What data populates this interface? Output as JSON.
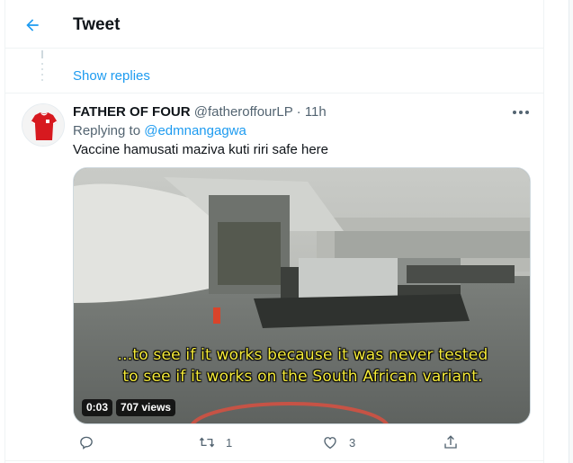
{
  "header": {
    "title": "Tweet",
    "back_icon": "arrow-left-icon"
  },
  "thread": {
    "show_replies": "Show replies"
  },
  "tweet": {
    "display_name": "FATHER OF FOUR",
    "handle": "@fatheroffourLP",
    "separator": "·",
    "time": "11h",
    "replying_prefix": "Replying to",
    "replying_to": "@edmnangagwa",
    "text": "Vaccine hamusati maziva kuti riri safe here",
    "more_icon": "more-horizontal-icon",
    "avatar_icon": "jersey-avatar",
    "video": {
      "subtitle_line1": "...to see if it works because it was never tested",
      "subtitle_line2": "to see if it works on the South African variant.",
      "duration": "0:03",
      "views": "707 views"
    },
    "actions": {
      "reply_count": "",
      "retweet_count": "1",
      "like_count": "3",
      "share_count": ""
    }
  },
  "colors": {
    "accent": "#1d9bf0",
    "text_primary": "#0f1419",
    "text_secondary": "#536471",
    "subtitle_yellow": "#f6ec3a"
  }
}
